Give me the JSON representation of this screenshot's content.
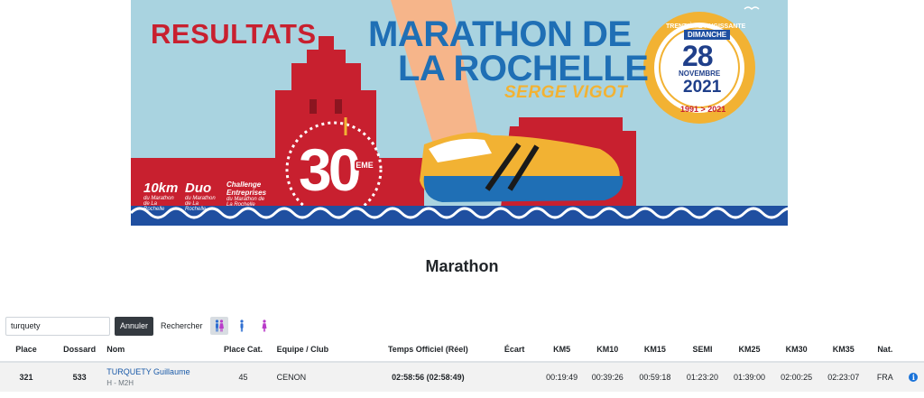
{
  "banner": {
    "resultats": "RESULTATS",
    "title_line1": "MARATHON DE",
    "title_line2": "LA ROCHELLE",
    "subtitle": "SERGE VIGOT",
    "anniversary_number": "30",
    "anniversary_suffix": "EME",
    "logos": [
      {
        "main": "10km",
        "small": "du Marathon de La Rochelle"
      },
      {
        "main": "Duo",
        "small": "du Marathon de La Rochelle"
      },
      {
        "main": "Challenge Entreprises",
        "small": "du Marathon de La Rochelle"
      }
    ],
    "badge": {
      "ring_text": "TRENTIÈME RUGISSANTE",
      "day": "DIMANCHE",
      "date": "28",
      "month": "NOVEMBRE",
      "year": "2021",
      "range": "1991 > 2021"
    },
    "colors": {
      "sky": "#a9d3e0",
      "red": "#c8202f",
      "blue": "#1f6fb5",
      "gold": "#f2b233"
    }
  },
  "event": {
    "title": "Marathon"
  },
  "search": {
    "value": "turquety",
    "cancel_label": "Annuler",
    "search_label": "Rechercher",
    "filters": [
      {
        "name": "all-genders",
        "icon": "couple-icon",
        "active": true
      },
      {
        "name": "men",
        "icon": "man-icon",
        "active": false
      },
      {
        "name": "women",
        "icon": "woman-icon",
        "active": false
      }
    ]
  },
  "table": {
    "headers": {
      "place": "Place",
      "bib": "Dossard",
      "name": "Nom",
      "cat_place": "Place Cat.",
      "club": "Equipe / Club",
      "official_time": "Temps Officiel (Réel)",
      "gap": "Écart",
      "km5": "KM5",
      "km10": "KM10",
      "km15": "KM15",
      "semi": "SEMI",
      "km25": "KM25",
      "km30": "KM30",
      "km35": "KM35",
      "nat": "Nat."
    },
    "rows": [
      {
        "place": "321",
        "bib": "533",
        "name": "TURQUETY Guillaume",
        "category": "H - M2H",
        "cat_place": "45",
        "club": "CENON",
        "official_time": "02:58:56 (02:58:49)",
        "gap": "",
        "km5": "00:19:49",
        "km10": "00:39:26",
        "km15": "00:59:18",
        "semi": "01:23:20",
        "km25": "01:39:00",
        "km30": "02:00:25",
        "km35": "02:23:07",
        "nat": "FRA",
        "info_icon": "info-icon"
      }
    ]
  }
}
